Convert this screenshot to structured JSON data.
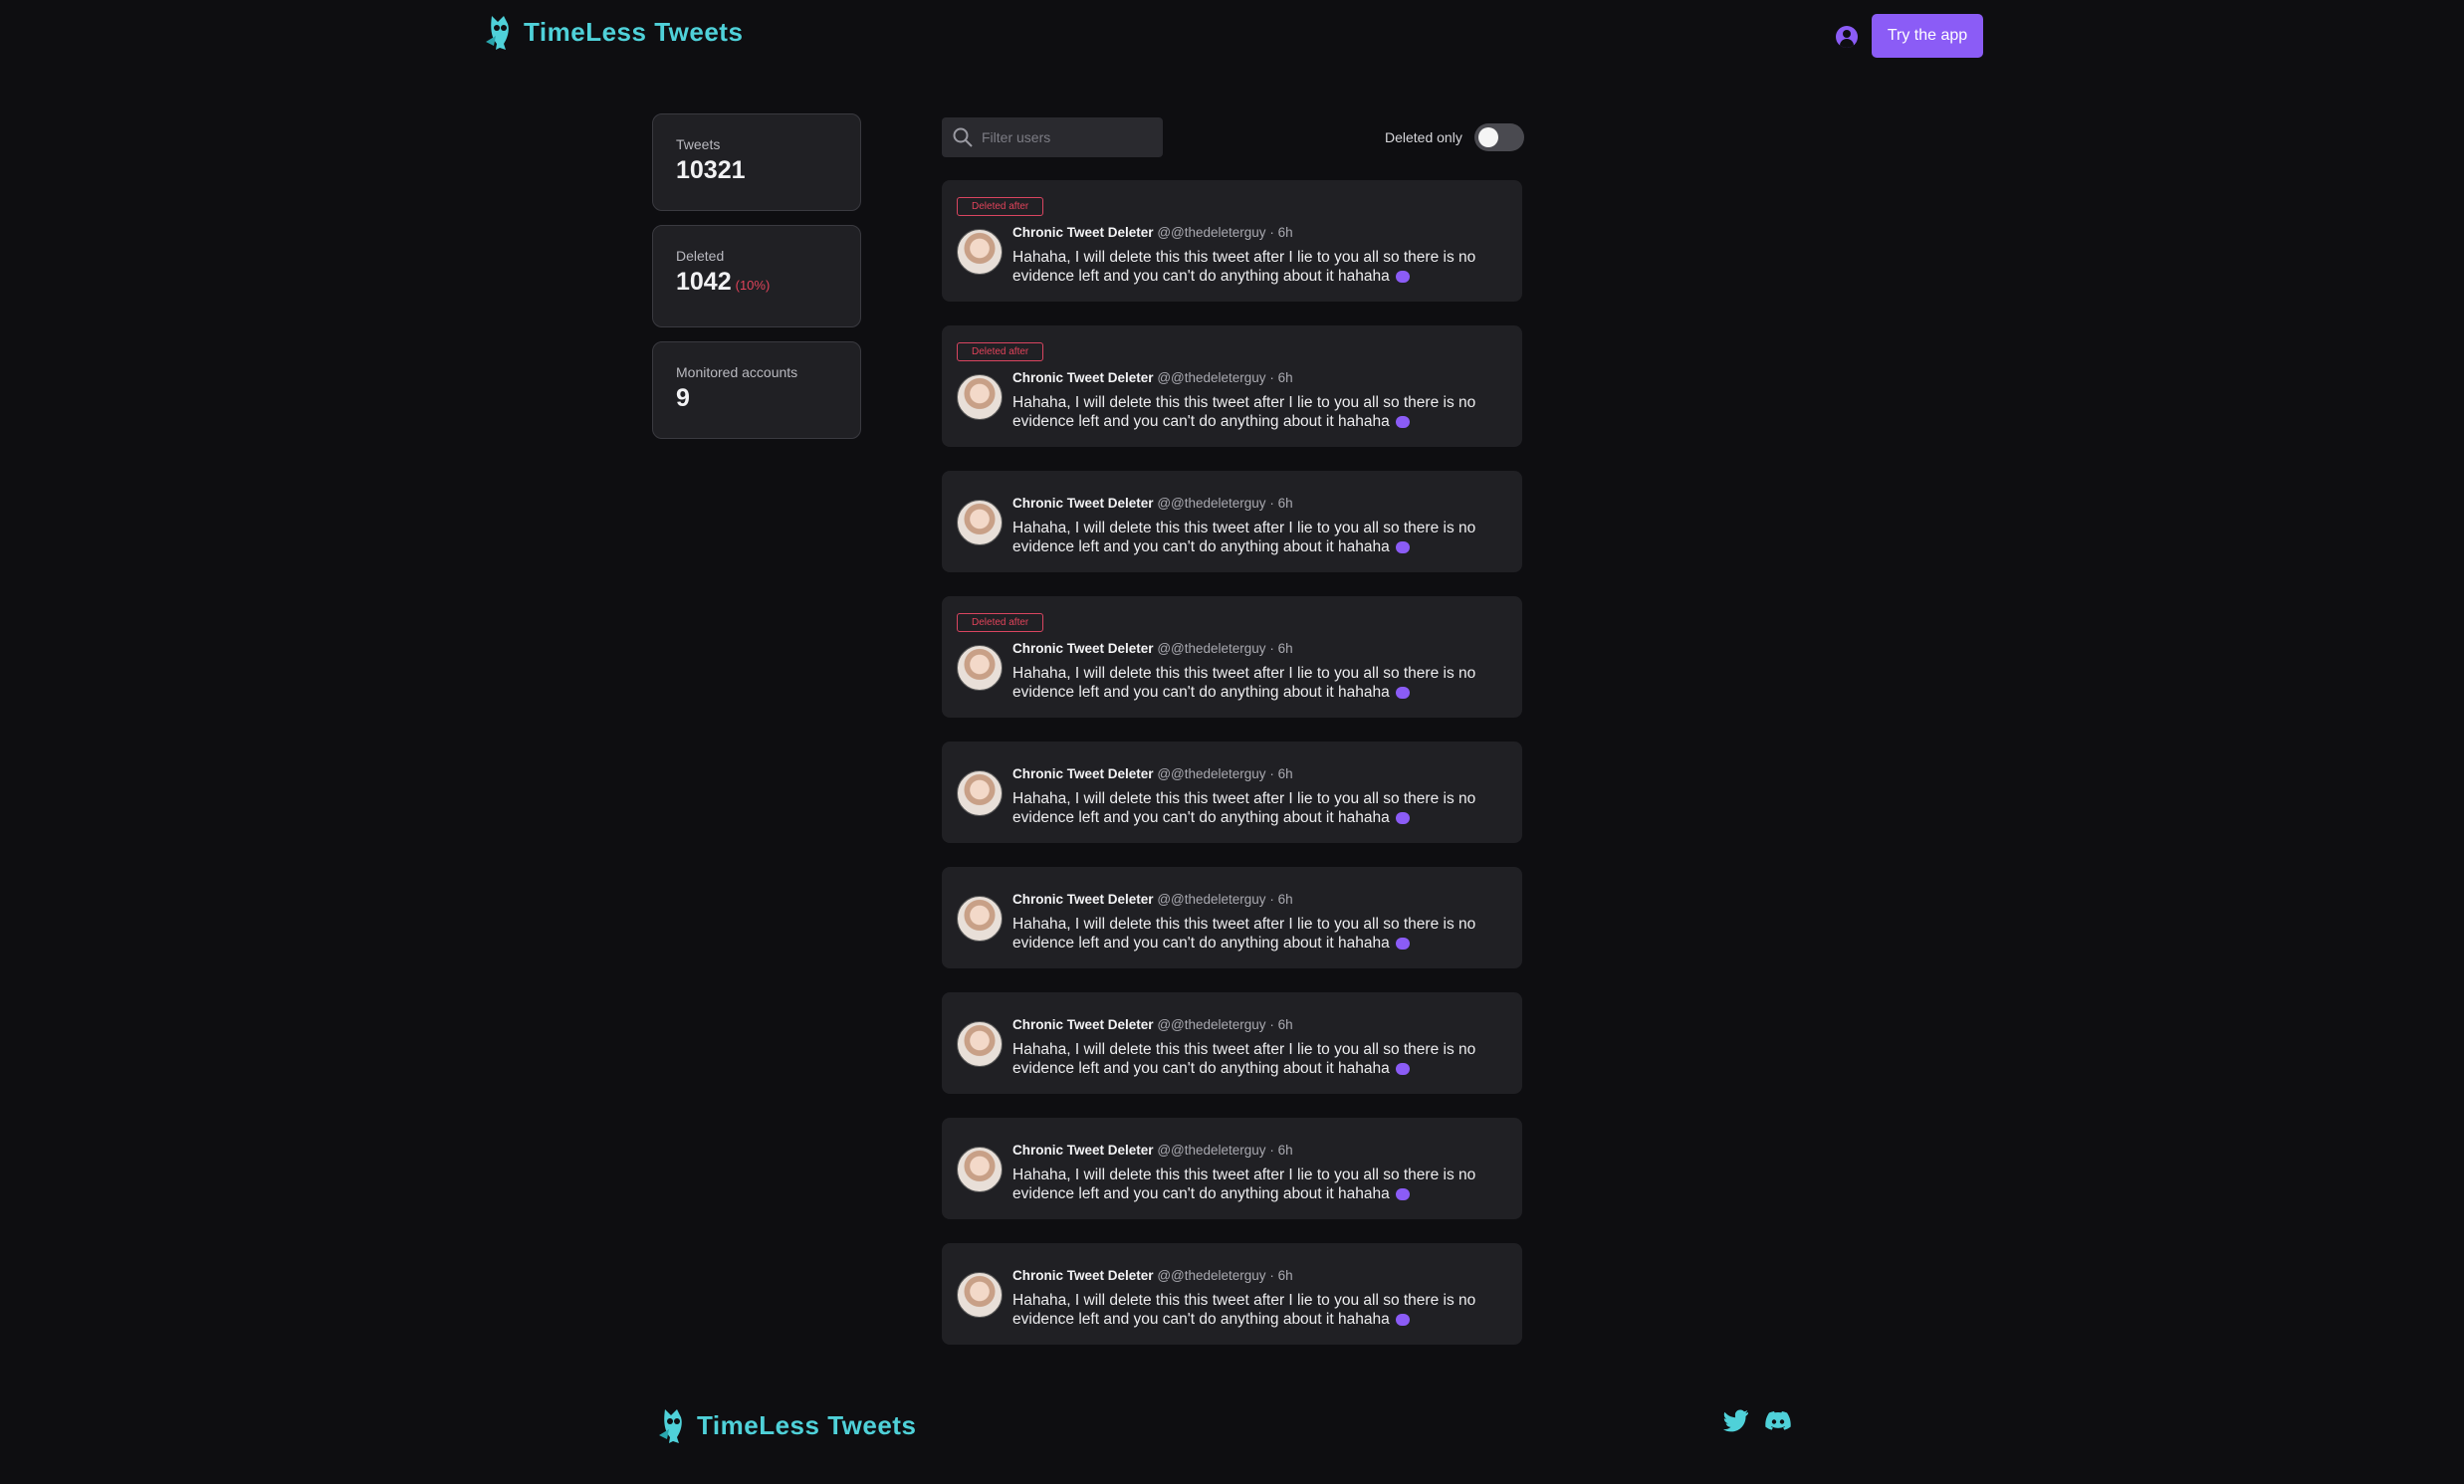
{
  "header": {
    "brand": "TimeLess Tweets",
    "try_app": "Try the app"
  },
  "stats": [
    {
      "label": "Tweets",
      "value": "10321"
    },
    {
      "label": "Deleted",
      "value": "1042",
      "extra": "(10%)"
    },
    {
      "label": "Monitored accounts",
      "value": "9"
    }
  ],
  "filter": {
    "placeholder": "Filter users",
    "deleted_only_label": "Deleted only",
    "deleted_only": false
  },
  "tweets": [
    {
      "badge": "Deleted after",
      "author": "Chronic Tweet Deleter",
      "handle": "@@thedeleterguy",
      "age": "6h",
      "text": "Hahaha, I will delete this this tweet after I lie to you all so there is no evidence left and you can't do anything about it hahaha"
    },
    {
      "badge": "Deleted after",
      "author": "Chronic Tweet Deleter",
      "handle": "@@thedeleterguy",
      "age": "6h",
      "text": "Hahaha, I will delete this this tweet after I lie to you all so there is no evidence left and you can't do anything about it hahaha"
    },
    {
      "badge": "",
      "author": "Chronic Tweet Deleter",
      "handle": "@@thedeleterguy",
      "age": "6h",
      "text": "Hahaha, I will delete this this tweet after I lie to you all so there is no evidence left and you can't do anything about it hahaha"
    },
    {
      "badge": "Deleted after",
      "author": "Chronic Tweet Deleter",
      "handle": "@@thedeleterguy",
      "age": "6h",
      "text": "Hahaha, I will delete this this tweet after I lie to you all so there is no evidence left and you can't do anything about it hahaha"
    },
    {
      "badge": "",
      "author": "Chronic Tweet Deleter",
      "handle": "@@thedeleterguy",
      "age": "6h",
      "text": "Hahaha, I will delete this this tweet after I lie to you all so there is no evidence left and you can't do anything about it hahaha"
    },
    {
      "badge": "",
      "author": "Chronic Tweet Deleter",
      "handle": "@@thedeleterguy",
      "age": "6h",
      "text": "Hahaha, I will delete this this tweet after I lie to you all so there is no evidence left and you can't do anything about it hahaha"
    },
    {
      "badge": "",
      "author": "Chronic Tweet Deleter",
      "handle": "@@thedeleterguy",
      "age": "6h",
      "text": "Hahaha, I will delete this this tweet after I lie to you all so there is no evidence left and you can't do anything about it hahaha"
    },
    {
      "badge": "",
      "author": "Chronic Tweet Deleter",
      "handle": "@@thedeleterguy",
      "age": "6h",
      "text": "Hahaha, I will delete this this tweet after I lie to you all so there is no evidence left and you can't do anything about it hahaha"
    },
    {
      "badge": "",
      "author": "Chronic Tweet Deleter",
      "handle": "@@thedeleterguy",
      "age": "6h",
      "text": "Hahaha, I will delete this this tweet after I lie to you all so there is no evidence left and you can't do anything about it hahaha"
    }
  ],
  "footer": {
    "brand": "TimeLess Tweets",
    "icons": [
      "twitter-icon",
      "discord-icon"
    ]
  },
  "colors": {
    "background": "#0e0e11",
    "brand": "#4fd1d9",
    "accent": "#8b5cf6",
    "deleted": "#e0435a",
    "card": "#202024"
  }
}
